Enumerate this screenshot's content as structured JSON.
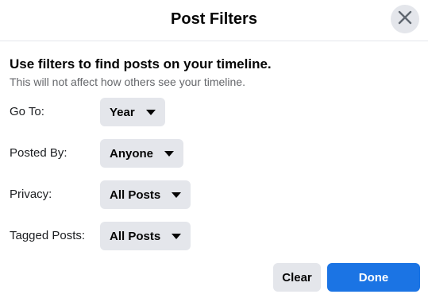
{
  "dialog": {
    "title": "Post Filters",
    "close_icon": "close-icon"
  },
  "intro": {
    "heading": "Use filters to find posts on your timeline.",
    "subheading": "This will not affect how others see your timeline."
  },
  "filters": [
    {
      "label": "Go To:",
      "value": "Year"
    },
    {
      "label": "Posted By:",
      "value": "Anyone"
    },
    {
      "label": "Privacy:",
      "value": "All Posts"
    },
    {
      "label": "Tagged Posts:",
      "value": "All Posts"
    }
  ],
  "footer": {
    "clear_label": "Clear",
    "done_label": "Done"
  },
  "colors": {
    "primary": "#1b74e4",
    "secondary_bg": "#e4e6eb",
    "secondary_text": "#65676b"
  }
}
